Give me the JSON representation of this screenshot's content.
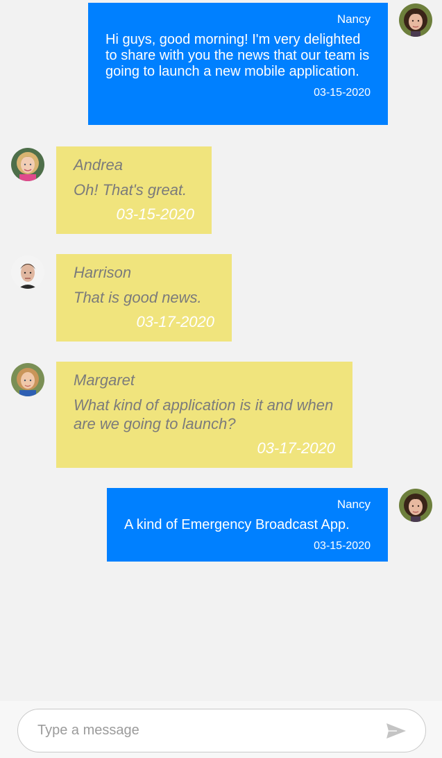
{
  "messages": [
    {
      "sender": "Nancy",
      "text": "Hi guys, good morning! I'm very delighted to share with you the news that our team is going to launch a new mobile application.",
      "time": "03-15-2020",
      "direction": "outgoing"
    },
    {
      "sender": "Andrea",
      "text": "Oh! That's great.",
      "time": "03-15-2020",
      "direction": "incoming"
    },
    {
      "sender": "Harrison",
      "text": "That is good news.",
      "time": "03-17-2020",
      "direction": "incoming"
    },
    {
      "sender": "Margaret",
      "text": "What kind of application is it and when are we going to launch?",
      "time": "03-17-2020",
      "direction": "incoming"
    },
    {
      "sender": "Nancy",
      "text": "A kind of Emergency Broadcast App.",
      "time": "03-15-2020",
      "direction": "outgoing"
    }
  ],
  "composer": {
    "placeholder": "Type a message",
    "value": "",
    "send_icon": "send-icon"
  },
  "colors": {
    "background": "#f2f2f2",
    "outgoing_bubble": "#0080ff",
    "incoming_bubble": "#f0e47d",
    "incoming_text": "#7b7b7b",
    "send_icon": "#c4c4c4"
  }
}
